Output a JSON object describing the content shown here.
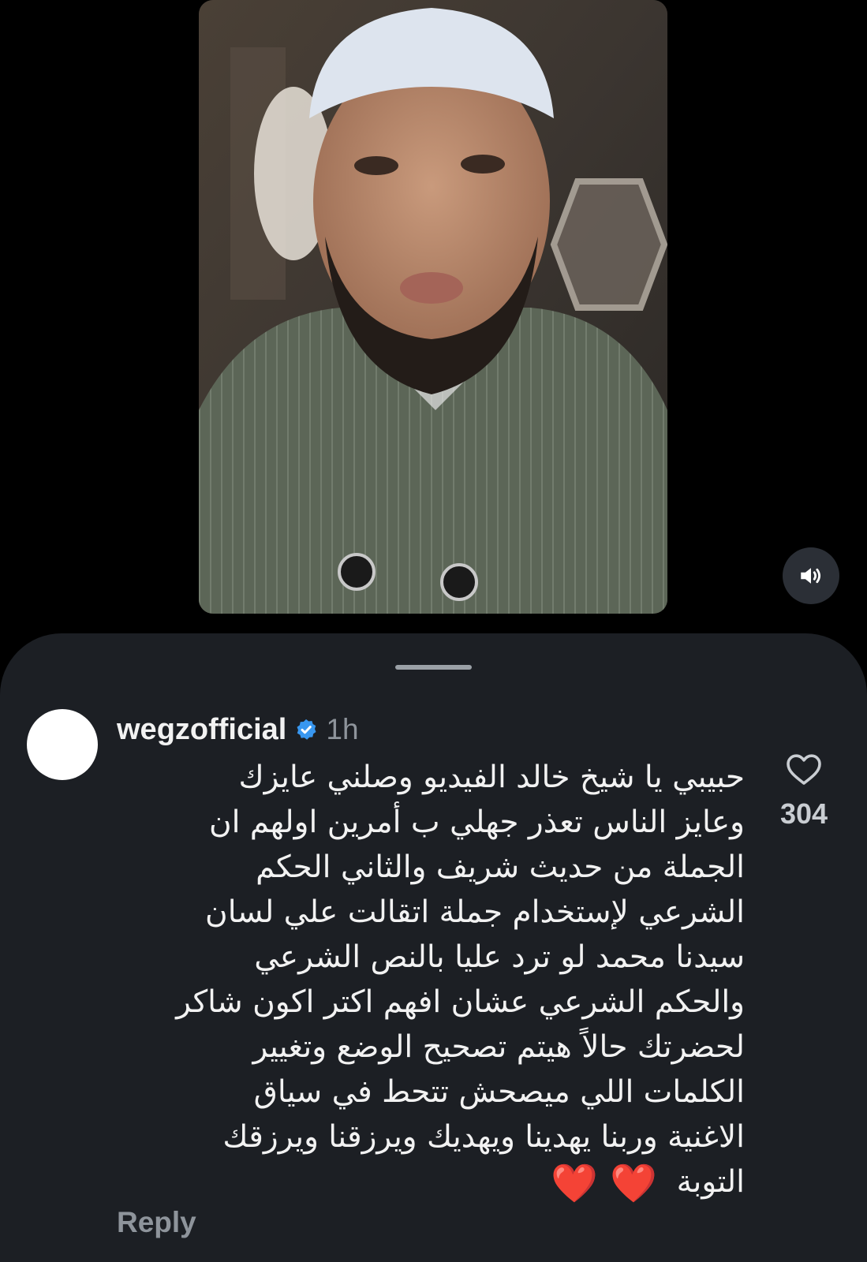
{
  "video": {
    "mute_icon": "speaker-volume-icon"
  },
  "comment": {
    "username": "wegzofficial",
    "verified_icon": "verified-badge-icon",
    "timestamp": "1h",
    "lines": [
      "حبيبي يا شيخ خالد الفيديو وصلني عايزك",
      "وعايز الناس تعذر جهلي ب أمرين اولهم ان",
      "الجملة من حديث شريف والثاني الحكم",
      "الشرعي لإستخدام جملة اتقالت علي لسان",
      "سيدنا محمد لو ترد عليا بالنص الشرعي",
      "والحكم الشرعي عشان افهم اكتر اكون شاكر",
      "لحضرتك حالاً هيتم تصحيح الوضع وتغيير",
      "الكلمات اللي ميصحش تتحط في سياق",
      "الاغنية وربنا يهدينا ويهديك ويرزقنا ويرزقك",
      "التوبة"
    ],
    "emojis": "❤️ ❤️",
    "like_count": "304",
    "like_icon": "heart-outline-icon",
    "reply_label": "Reply"
  },
  "colors": {
    "page_background": "#000000",
    "sheet_background": "#1c1f24",
    "primary_text": "#f2f2f2",
    "secondary_text": "#8e949b",
    "verified_blue": "#3897f0",
    "heart_red": "#e11d2b"
  }
}
